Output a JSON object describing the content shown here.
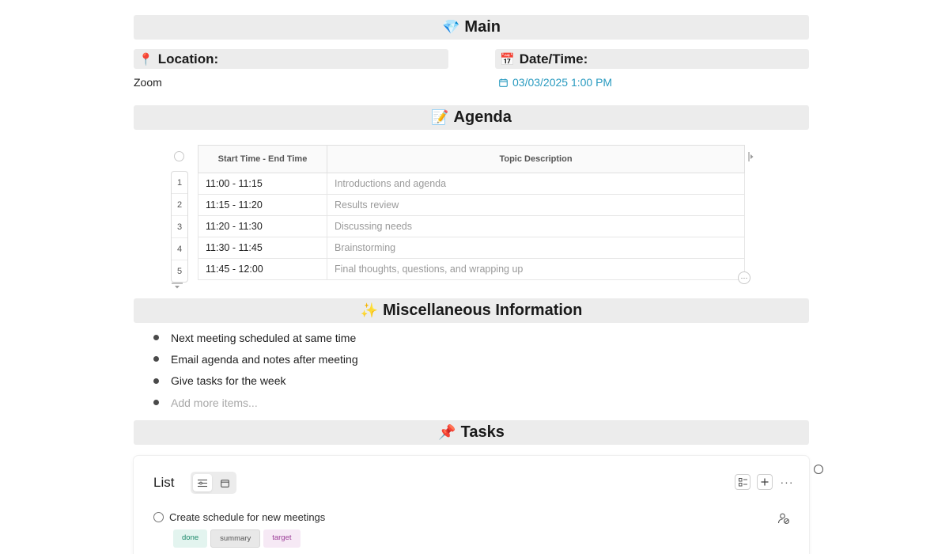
{
  "sections": {
    "main": {
      "emoji": "💎",
      "title": "Main"
    },
    "agenda": {
      "emoji": "📝",
      "title": "Agenda"
    },
    "misc": {
      "emoji": "✨",
      "title": "Miscellaneous Information"
    },
    "tasks": {
      "emoji": "📌",
      "title": "Tasks"
    }
  },
  "location": {
    "emoji": "📍",
    "label": "Location:",
    "value": "Zoom"
  },
  "datetime": {
    "emoji": "📅",
    "label": "Date/Time:",
    "value": "03/03/2025 1:00 PM"
  },
  "agenda_table": {
    "headers": [
      "Start Time - End Time",
      "Topic Description"
    ],
    "rows": [
      {
        "num": "1",
        "time": "11:00 - 11:15",
        "topic": "Introductions and agenda"
      },
      {
        "num": "2",
        "time": "11:15 - 11:20",
        "topic": "Results review"
      },
      {
        "num": "3",
        "time": "11:20 - 11:30",
        "topic": "Discussing needs"
      },
      {
        "num": "4",
        "time": "11:30 - 11:45",
        "topic": "Brainstorming"
      },
      {
        "num": "5",
        "time": "11:45 - 12:00",
        "topic": "Final thoughts, questions, and wrapping up"
      }
    ],
    "more_label": "···"
  },
  "misc_items": [
    "Next meeting scheduled at same time",
    "Email agenda and notes after meeting",
    "Give tasks for the week"
  ],
  "misc_placeholder": "Add more items...",
  "tasks_card": {
    "title": "List",
    "more_label": "···",
    "task": {
      "label": "Create schedule for new meetings",
      "tags": [
        "done",
        "summary",
        "target"
      ]
    }
  },
  "colors": {
    "band": "#ececec",
    "date_accent": "#2a9bc0",
    "tag_done": "#1d8a6b",
    "tag_target": "#9d3f99"
  }
}
